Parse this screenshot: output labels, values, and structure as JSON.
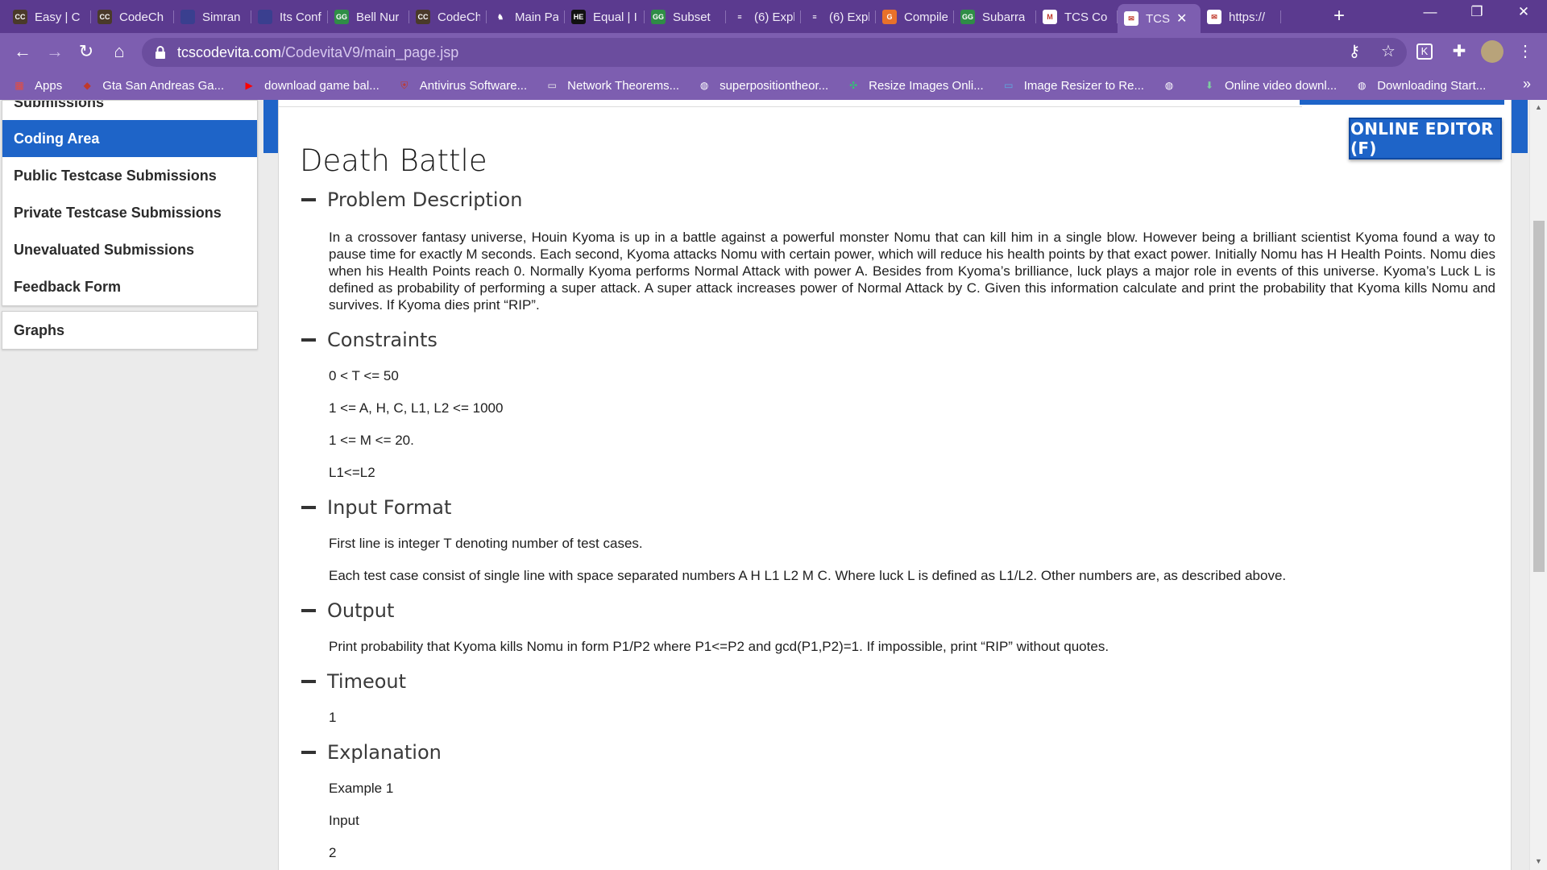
{
  "browser": {
    "tabs": [
      {
        "label": "Easy | C",
        "fav": "CC",
        "favColor": "#4a3a2a"
      },
      {
        "label": "CodeCh",
        "fav": "CC",
        "favColor": "#4a3a2a"
      },
      {
        "label": "Simran",
        "fav": "",
        "favColor": "#3a3f8f"
      },
      {
        "label": "Its Conf",
        "fav": "",
        "favColor": "#3a3f8f"
      },
      {
        "label": "Bell Nur",
        "fav": "GG",
        "favColor": "#2f8d46"
      },
      {
        "label": "CodeCh",
        "fav": "CC",
        "favColor": "#4a3a2a"
      },
      {
        "label": "Main Pa",
        "fav": "♞",
        "favColor": "#5b3a8f"
      },
      {
        "label": "Equal | I",
        "fav": "HE",
        "favColor": "#111111"
      },
      {
        "label": "Subset",
        "fav": "GG",
        "favColor": "#2f8d46"
      },
      {
        "label": "(6) Expl",
        "fav": "≡",
        "favColor": "#5b3a8f"
      },
      {
        "label": "(6) Expl",
        "fav": "≡",
        "favColor": "#5b3a8f"
      },
      {
        "label": "Compile",
        "fav": "G",
        "favColor": "#e8712a"
      },
      {
        "label": "Subarra",
        "fav": "GG",
        "favColor": "#2f8d46"
      },
      {
        "label": "TCS Co",
        "fav": "M",
        "favColor": "#ffffff"
      },
      {
        "label": "TCS",
        "fav": "✉",
        "favColor": "#ffffff"
      },
      {
        "label": "https://",
        "fav": "✉",
        "favColor": "#ffffff"
      }
    ],
    "url_domain": "tcscodevita.com",
    "url_path": "/CodevitaV9/main_page.jsp",
    "bookmarks": [
      {
        "label": "Apps"
      },
      {
        "label": "Gta San Andreas Ga..."
      },
      {
        "label": "download game bal..."
      },
      {
        "label": "Antivirus Software..."
      },
      {
        "label": "Network Theorems..."
      },
      {
        "label": "superpositiontheor..."
      },
      {
        "label": "Resize Images Onli..."
      },
      {
        "label": "Image Resizer to Re..."
      },
      {
        "label": ""
      },
      {
        "label": "Online video downl..."
      },
      {
        "label": "Downloading Start..."
      }
    ]
  },
  "sidebar": {
    "cut_item": "Submissions",
    "items": [
      {
        "label": "Coding Area",
        "active": true
      },
      {
        "label": "Public Testcase Submissions"
      },
      {
        "label": "Private Testcase Submissions"
      },
      {
        "label": "Unevaluated Submissions"
      },
      {
        "label": "Feedback Form"
      }
    ],
    "graphs": "Graphs"
  },
  "editor_button": "ONLINE EDITOR (F)",
  "problem": {
    "title": "Death Battle",
    "sections": {
      "description": {
        "heading": "Problem Description",
        "text": "In a crossover fantasy universe, Houin Kyoma is up in a battle against a powerful monster Nomu that can kill him in a single blow. However being a brilliant scientist Kyoma found a way to pause time for exactly M seconds. Each second, Kyoma attacks Nomu with certain power, which will reduce his health points by that exact power. Initially Nomu has H Health Points. Nomu dies when his Health Points reach 0. Normally Kyoma performs Normal Attack with power A. Besides from Kyoma’s brilliance, luck plays a major role in events of this universe. Kyoma’s Luck L is defined as probability of performing a super attack. A super attack increases power of Normal Attack by C. Given this information calculate and print the probability that Kyoma kills Nomu and survives. If Kyoma dies print “RIP”."
      },
      "constraints": {
        "heading": "Constraints",
        "lines": [
          "0 < T <= 50",
          "1 <= A, H, C, L1, L2 <= 1000",
          "1 <= M <= 20.",
          "L1<=L2"
        ]
      },
      "input": {
        "heading": "Input Format",
        "lines": [
          "First line is integer T denoting number of test cases.",
          "Each test case consist of single line with space separated numbers A H L1 L2 M C. Where luck L is defined as L1/L2. Other numbers are, as described above."
        ]
      },
      "output": {
        "heading": "Output",
        "text": "Print probability that Kyoma kills Nomu in form P1/P2 where P1<=P2 and gcd(P1,P2)=1. If impossible, print “RIP” without quotes."
      },
      "timeout": {
        "heading": "Timeout",
        "text": "1"
      },
      "explanation": {
        "heading": "Explanation",
        "lines": [
          "Example 1",
          "Input",
          "2"
        ]
      }
    }
  }
}
